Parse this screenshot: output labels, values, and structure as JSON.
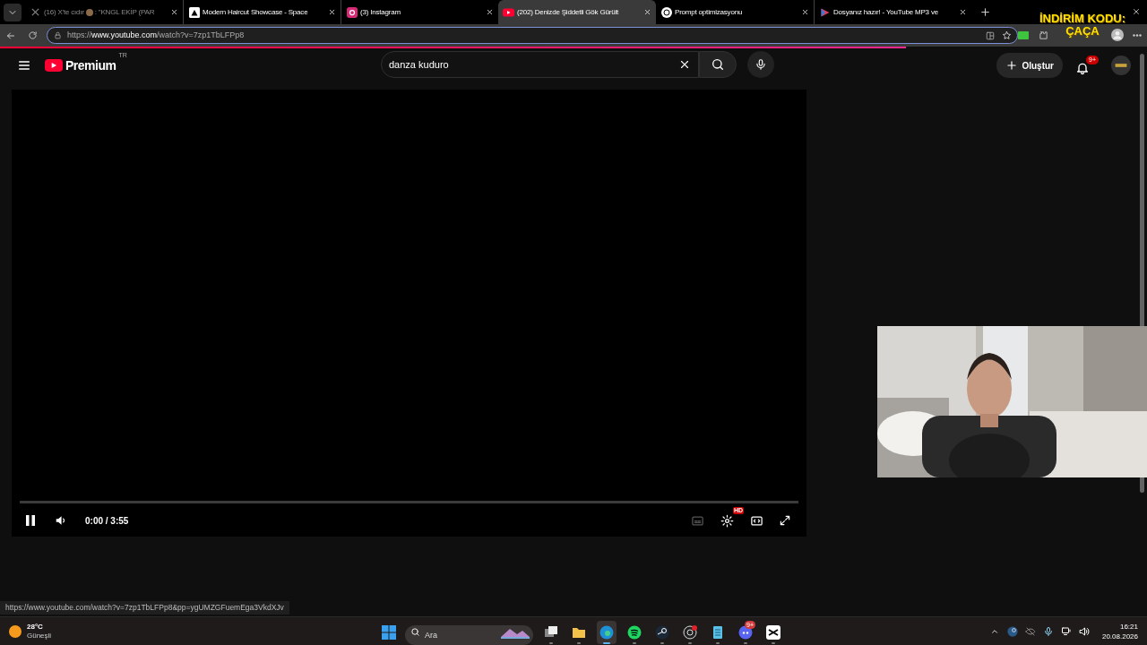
{
  "browser": {
    "tabs": [
      {
        "kind": "x",
        "title": "(16) X'te cıdır",
        "title_after_icon": ": \"KNGL EKİP (PAR",
        "selected": false,
        "dimmed": true
      },
      {
        "kind": "spaces",
        "title": "Modern Haircut Showcase - Space",
        "selected": false,
        "dimmed": false
      },
      {
        "kind": "instagram",
        "title": "(3) Instagram",
        "selected": false,
        "dimmed": false
      },
      {
        "kind": "youtube",
        "title": "(202) Denizde Şiddetli Gök Gürült",
        "selected": true,
        "dimmed": false
      },
      {
        "kind": "chat",
        "title": "Prompt optimizasyonu",
        "selected": false,
        "dimmed": false
      },
      {
        "kind": "mp3",
        "title": "Dosyanız hazır! - YouTube MP3 ve",
        "selected": false,
        "dimmed": false
      }
    ],
    "address": {
      "scheme": "https://",
      "host": "www.youtube.com",
      "path": "/watch?v=7zp1TbLFPp8"
    },
    "load_progress": {
      "level": 0.79
    },
    "overlay": {
      "line1": "İNDİRİM KODU:",
      "line2": "ÇAÇA"
    }
  },
  "youtube": {
    "logo": "Premium",
    "region": "TR",
    "search": {
      "value": "danza kuduro"
    },
    "create": "Oluştur",
    "notifications": "9+"
  },
  "player": {
    "playing": true,
    "time": "0:00 / 3:55",
    "quality_badge": "HD"
  },
  "status_url": "https://www.youtube.com/watch?v=7zp1TbLFPp8&pp=ygUMZGFuemEga3VkdXJv",
  "taskbar": {
    "weather": {
      "temp": "28°C",
      "condition": "Güneşli"
    },
    "search": {
      "placeholder": "Ara"
    },
    "apps": [
      {
        "kind": "taskview",
        "active": false
      },
      {
        "kind": "explorer",
        "active": false
      },
      {
        "kind": "edge",
        "active": true
      },
      {
        "kind": "spotify",
        "active": false
      },
      {
        "kind": "steam",
        "active": false
      },
      {
        "kind": "obs",
        "active": false
      },
      {
        "kind": "notepad",
        "active": false
      },
      {
        "kind": "discord",
        "active": false,
        "badge": "9+"
      },
      {
        "kind": "capcut",
        "active": false
      }
    ],
    "clock": {
      "time": "16:21",
      "date": "20.08.2026"
    }
  }
}
